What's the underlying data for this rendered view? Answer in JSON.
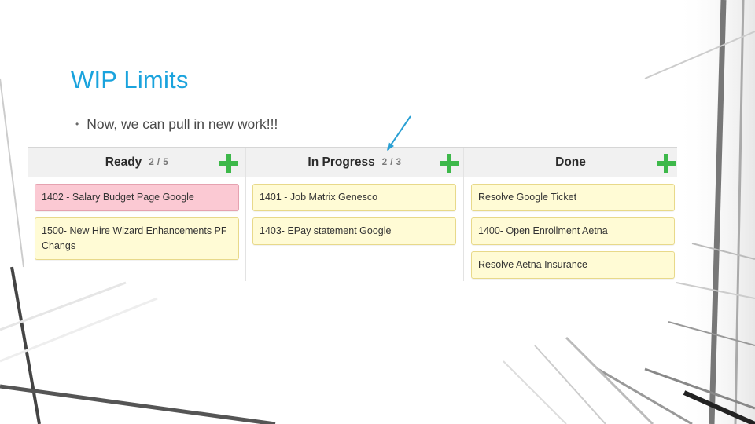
{
  "slide": {
    "title": "WIP Limits",
    "bullets": [
      "Now, we can pull in new work!!!"
    ],
    "accent_color": "#1aa3dd"
  },
  "annotation": {
    "icon": "arrow-icon",
    "color": "#2aa0d4",
    "points_to": "In Progress WIP count"
  },
  "board": {
    "add_icon": "plus-icon",
    "add_color": "#3db84a",
    "columns": [
      {
        "name": "Ready",
        "wip_count": "2 / 5",
        "cards": [
          {
            "text": "1402 - Salary Budget Page Google",
            "status": "blocked",
            "color": "#fbc9d3"
          },
          {
            "text": "1500- New Hire Wizard Enhancements PF Changs",
            "status": "normal",
            "color": "#fffbd5"
          }
        ]
      },
      {
        "name": "In Progress",
        "wip_count": "2 / 3",
        "cards": [
          {
            "text": "1401 - Job Matrix Genesco",
            "status": "normal",
            "color": "#fffbd5"
          },
          {
            "text": "1403- EPay statement Google",
            "status": "normal",
            "color": "#fffbd5"
          }
        ]
      },
      {
        "name": "Done",
        "wip_count": "",
        "cards": [
          {
            "text": "Resolve Google Ticket",
            "status": "normal",
            "color": "#fffbd5"
          },
          {
            "text": "1400- Open Enrollment Aetna",
            "status": "normal",
            "color": "#fffbd5"
          },
          {
            "text": "Resolve Aetna Insurance",
            "status": "normal",
            "color": "#fffbd5"
          }
        ]
      }
    ]
  }
}
